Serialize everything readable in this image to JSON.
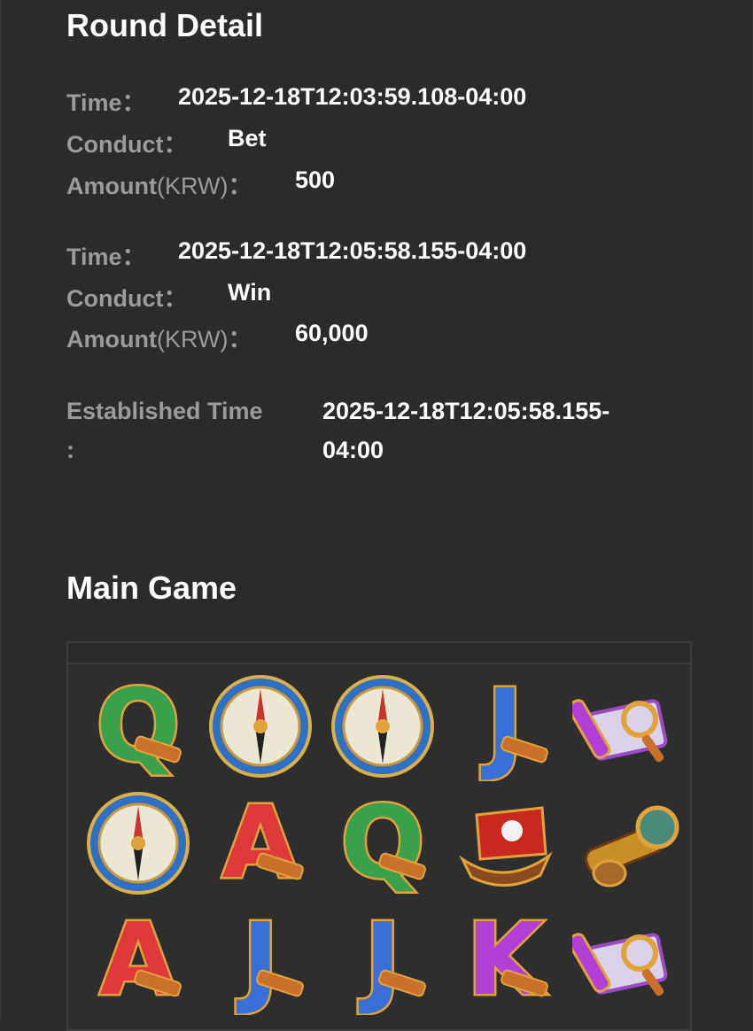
{
  "page": {
    "title": "Round Detail",
    "section_title": "Main Game"
  },
  "records": [
    {
      "time_label": "Time：",
      "time": "2025-12-18T12:03:59.108-04:00",
      "conduct_label": "Conduct：",
      "conduct": "Bet",
      "amount_label": "Amount",
      "amount_unit": "(KRW)",
      "amount_colon": "：",
      "amount": "500"
    },
    {
      "time_label": "Time：",
      "time": "2025-12-18T12:05:58.155-04:00",
      "conduct_label": "Conduct：",
      "conduct": "Win",
      "amount_label": "Amount",
      "amount_unit": "(KRW)",
      "amount_colon": "：",
      "amount": "60,000"
    }
  ],
  "established": {
    "label": "Established Time",
    "colon": ":",
    "value_line1": "2025-12-18T12:05:58.155-",
    "value_line2": "04:00"
  },
  "reels": [
    [
      "Q",
      "compass",
      "compass",
      "J",
      "map"
    ],
    [
      "compass",
      "A",
      "Q",
      "ship",
      "spyglass"
    ],
    [
      "A",
      "J",
      "J",
      "K",
      "map"
    ]
  ],
  "colors": {
    "background": "#2b2b2b",
    "label": "#9b9b9b",
    "value": "#ffffff",
    "Q": "#3aa14a",
    "A": "#e0393a",
    "J": "#3a6fd8",
    "K": "#b23fd6",
    "gold": "#e0a23a"
  }
}
